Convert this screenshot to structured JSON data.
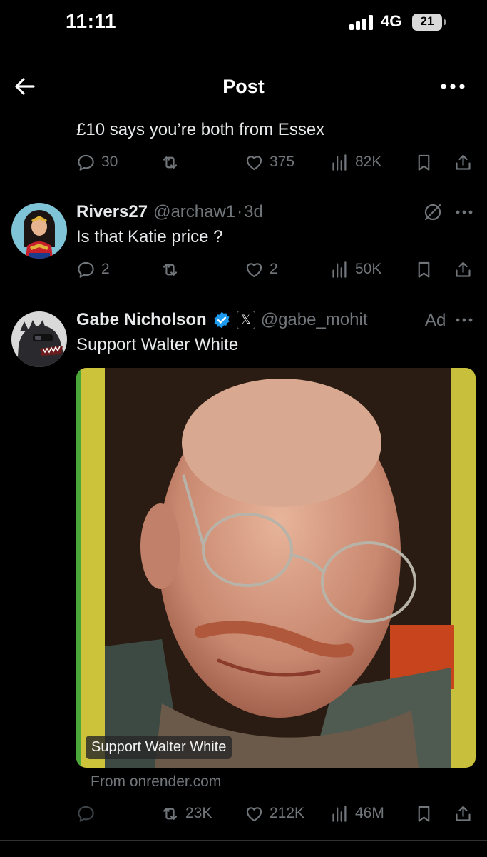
{
  "status": {
    "time": "11:11",
    "network": "4G",
    "battery": "21"
  },
  "header": {
    "title": "Post"
  },
  "tweet_top": {
    "text": "£10 says you’re both from Essex",
    "replies": "30",
    "likes": "375",
    "views": "82K"
  },
  "reply": {
    "name": "Rivers27",
    "handle": "@archaw1",
    "separator": "·",
    "time": "3d",
    "text": "Is that Katie price ?",
    "replies": "2",
    "likes": "2",
    "views": "50K"
  },
  "ad": {
    "name": "Gabe Nicholson",
    "badge": "𝕏",
    "handle": "@gabe_mohit",
    "ad_label": "Ad",
    "text": "Support Walter White",
    "media_caption": "Support Walter White",
    "source": "From onrender.com",
    "retweets": "23K",
    "likes": "212K",
    "views": "46M"
  },
  "colors": {
    "background": "#000000",
    "text": "#e7e9ea",
    "muted": "#71767b",
    "divider": "#2f3336",
    "verified": "#1d9bf0"
  }
}
